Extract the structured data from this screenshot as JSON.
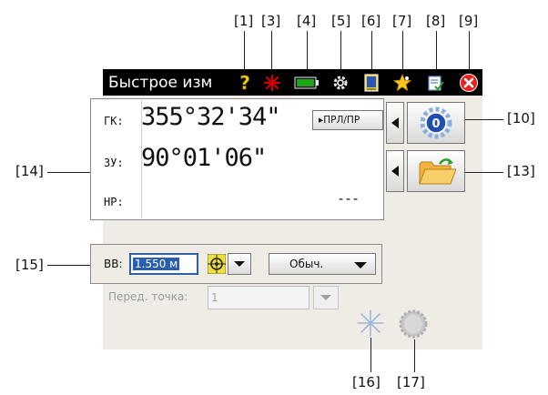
{
  "window": {
    "title": "Быстрое изм"
  },
  "status_icons": [
    {
      "callout": "[1]",
      "icon": "help-icon"
    },
    {
      "callout": "[3]",
      "icon": "laser-icon"
    },
    {
      "callout": "[4]",
      "icon": "battery-icon"
    },
    {
      "callout": "[5]",
      "icon": "settings-icon"
    },
    {
      "callout": "[6]",
      "icon": "job-file-icon"
    },
    {
      "callout": "[7]",
      "icon": "favorites-star-icon"
    },
    {
      "callout": "[8]",
      "icon": "task-list-icon"
    },
    {
      "callout": "[9]",
      "icon": "close-icon"
    }
  ],
  "measurement": {
    "hz_label": "ГК:",
    "hz_value": "355°32'34\"",
    "v_label": "ЗУ:",
    "v_value": "90°01'06\"",
    "sd_label": "НР:",
    "sd_value": "---",
    "prl_button": "▸ПРЛ/ПР"
  },
  "side_buttons": {
    "zero_hz_callout": "[10]",
    "zero_hz_glyph": "0",
    "open_job_callout": "[13]"
  },
  "callouts": {
    "c10": "[10]",
    "c13": "[13]",
    "c14": "[14]",
    "c15": "[15]",
    "c16": "[16]",
    "c17": "[17]"
  },
  "target_height": {
    "label": "ВВ:",
    "value": "1.550 м",
    "mode": "Обыч."
  },
  "backsight": {
    "label": "Перед. точка:",
    "value": "1"
  },
  "colors": {
    "title_bar": "#000000",
    "content_bg": "#eeece4",
    "laser": "#cc0000",
    "battery": "#1a9a1a",
    "close": "#e02020",
    "star": "#f2b818",
    "selection": "#2a5fb0"
  }
}
